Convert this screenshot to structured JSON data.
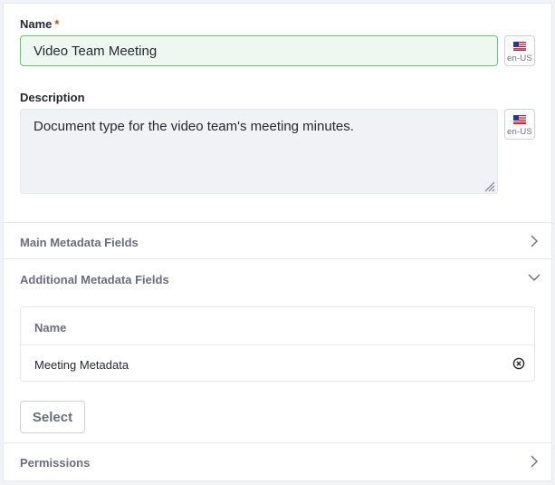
{
  "form": {
    "name_label": "Name",
    "required_mark": "*",
    "name_value": "Video Team Meeting",
    "description_label": "Description",
    "description_value": "Document type for the video team's meeting minutes.",
    "locale": "en-US",
    "flag_icon": "us-flag-icon"
  },
  "sections": {
    "main_metadata": {
      "title": "Main Metadata Fields",
      "expanded": false
    },
    "additional_metadata": {
      "title": "Additional Metadata Fields",
      "expanded": true,
      "table": {
        "column_header": "Name",
        "rows": [
          {
            "name": "Meeting Metadata"
          }
        ]
      },
      "select_label": "Select"
    },
    "permissions": {
      "title": "Permissions",
      "expanded": false
    }
  },
  "colors": {
    "accent_valid": "#5aca75",
    "required": "#b95000",
    "muted_text": "#6b6c7e"
  }
}
